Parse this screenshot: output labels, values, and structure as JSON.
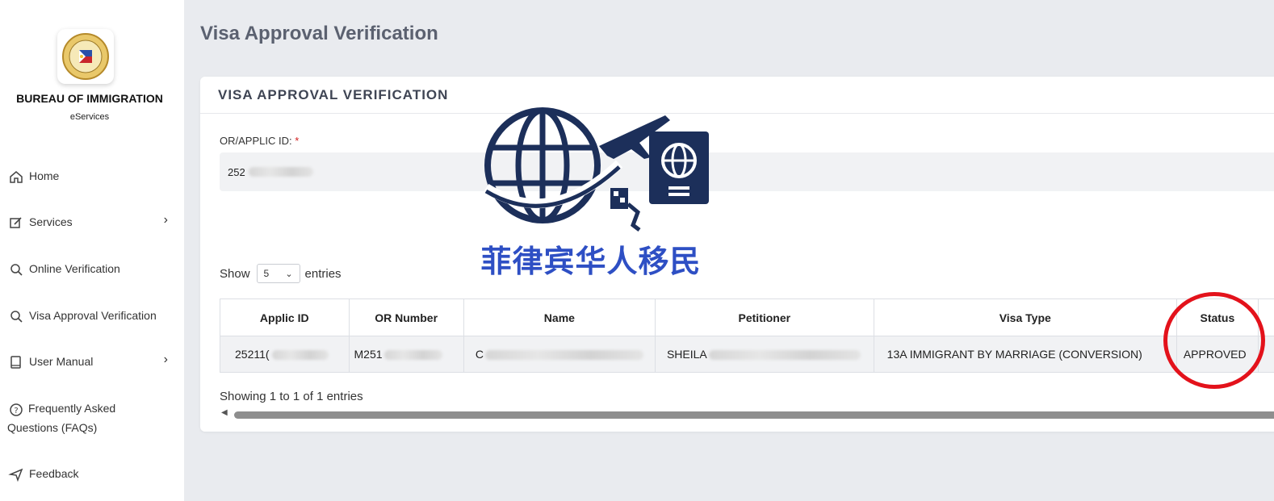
{
  "sidebar": {
    "org_name": "BUREAU OF IMMIGRATION",
    "org_sub": "eServices",
    "items": [
      {
        "label": "Home",
        "icon": "home-icon"
      },
      {
        "label": "Services",
        "icon": "edit-icon",
        "has_submenu": true
      },
      {
        "label": "Online Verification",
        "icon": "search-icon"
      },
      {
        "label": "Visa Approval Verification",
        "icon": "search-icon"
      },
      {
        "label": "User Manual",
        "icon": "book-icon",
        "has_submenu": true
      },
      {
        "label": "Frequently Asked Questions (FAQs)",
        "icon": "help-circle-icon"
      },
      {
        "label": "Feedback",
        "icon": "send-icon"
      }
    ]
  },
  "main": {
    "page_title": "Visa Approval Verification",
    "card_title": "VISA APPROVAL VERIFICATION",
    "field_label": "OR/APPLIC ID:",
    "field_required": "*",
    "field_value": "252",
    "show_label": "Show",
    "entries_value": "5",
    "entries_label": "entries",
    "table": {
      "headers": [
        "Applic ID",
        "OR Number",
        "Name",
        "Petitioner",
        "Visa Type",
        "Status"
      ],
      "row": {
        "applic_id": "25211(",
        "or_number": "M251",
        "name": "C",
        "petitioner": "SHEILA",
        "visa_type": "13A IMMIGRANT BY MARRIAGE (CONVERSION)",
        "status": "APPROVED"
      }
    },
    "footer_info": "Showing 1 to 1 of 1 entries"
  },
  "watermark": {
    "text": "菲律宾华人移民"
  },
  "colors": {
    "accent_red": "#e3121b",
    "watermark_navy": "#1c2f5a",
    "watermark_blue": "#2e4fc4"
  }
}
